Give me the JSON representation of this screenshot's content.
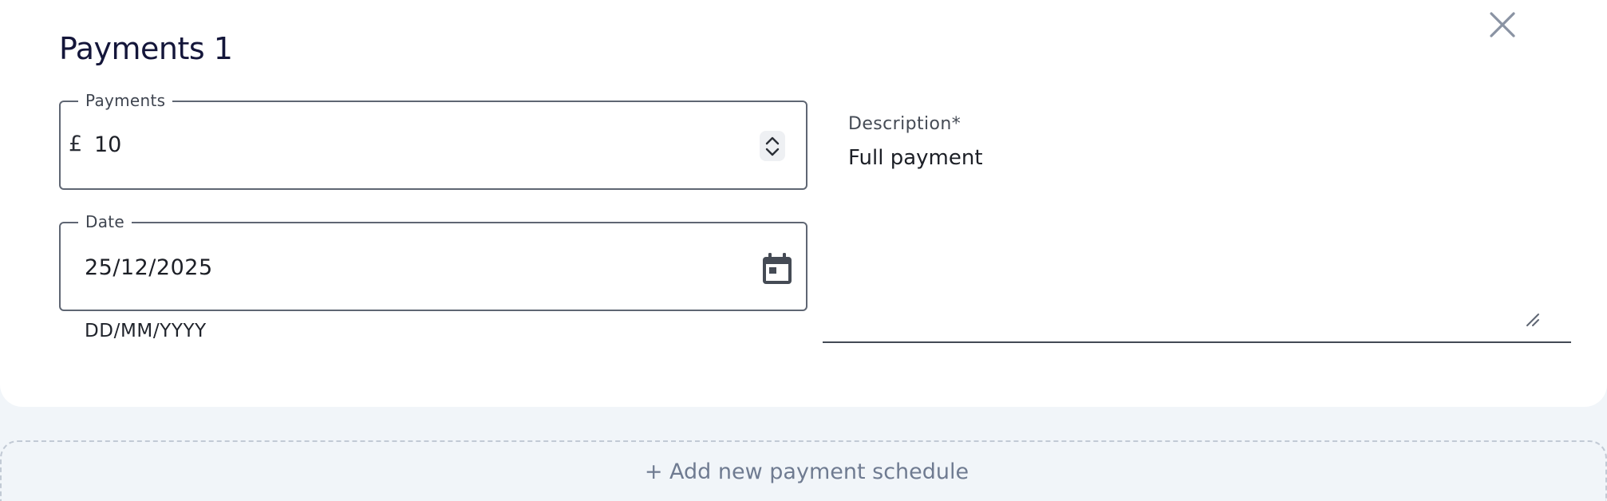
{
  "modal": {
    "title": "Payments 1",
    "close_icon": "close-icon"
  },
  "payments_field": {
    "label": "Payments",
    "currency_symbol": "£",
    "value": "10",
    "stepper_icon": "chevron-up-down-icon"
  },
  "date_field": {
    "label": "Date",
    "value": "25/12/2025",
    "helper_text": "DD/MM/YYYY",
    "calendar_icon": "calendar-icon"
  },
  "description_field": {
    "label": "Description*",
    "value": "Full payment",
    "resize_icon": "resize-handle-icon"
  },
  "add_schedule": {
    "label": "+ Add new payment schedule"
  },
  "colors": {
    "page_background": "#f1f5f9",
    "card_background": "#ffffff",
    "title": "#14163a",
    "border": "#5f6673",
    "add_label": "#6f7b91"
  }
}
